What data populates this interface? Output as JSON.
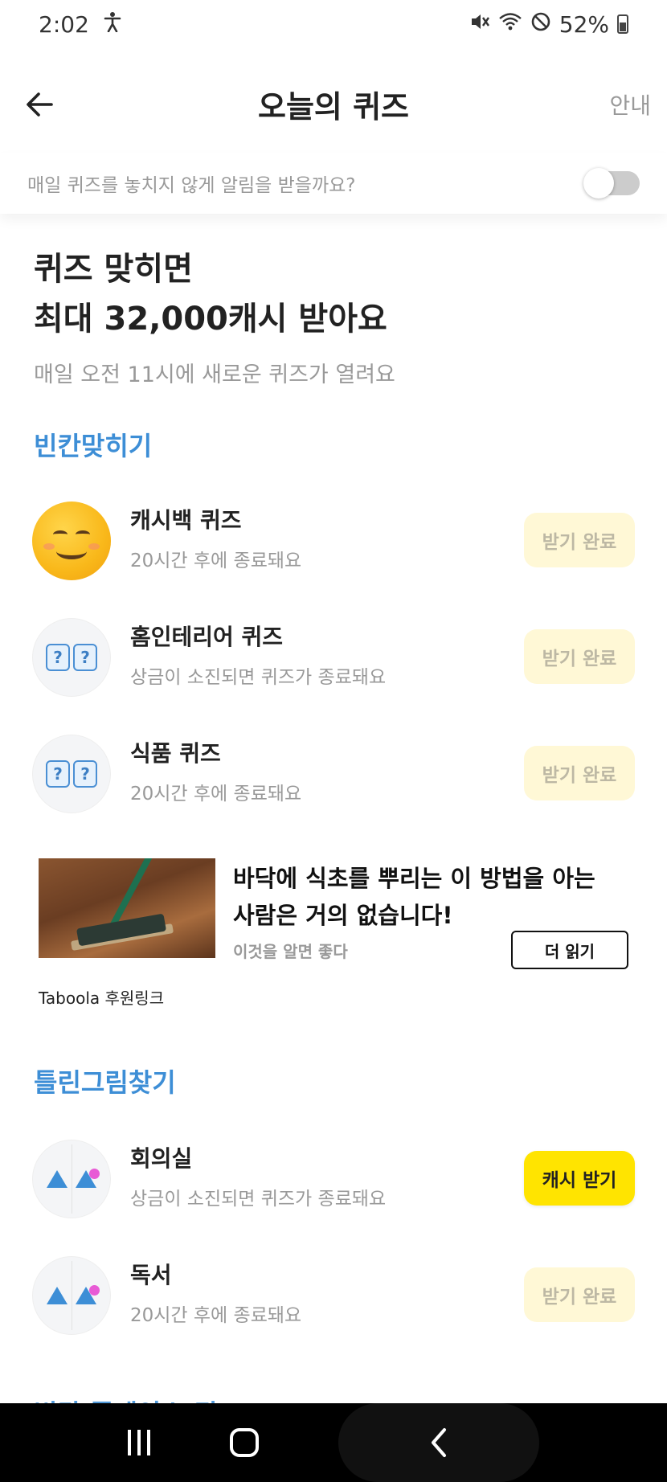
{
  "status": {
    "time": "2:02",
    "battery": "52%"
  },
  "header": {
    "title": "오늘의 퀴즈",
    "guide": "안내"
  },
  "notify": {
    "text": "매일 퀴즈를 놓치지 않게 알림을 받을까요?",
    "enabled": false
  },
  "hero": {
    "line1": "퀴즈 맞히면",
    "line2": "최대 32,000캐시 받아요",
    "sub": "매일 오전 11시에 새로운 퀴즈가 열려요"
  },
  "sections": {
    "fill_blank": {
      "title": "빈칸맞히기",
      "items": [
        {
          "title": "캐시백 퀴즈",
          "desc": "20시간 후에 종료돼요",
          "button": "받기 완료"
        },
        {
          "title": "홈인테리어 퀴즈",
          "desc": "상금이 소진되면 퀴즈가 종료돼요",
          "button": "받기 완료"
        },
        {
          "title": "식품 퀴즈",
          "desc": "20시간 후에 종료돼요",
          "button": "받기 완료"
        }
      ]
    },
    "spot_diff": {
      "title": "틀린그림찾기",
      "items": [
        {
          "title": "회의실",
          "desc": "상금이 소진되면 퀴즈가 종료돼요",
          "button": "캐시 받기"
        },
        {
          "title": "독서",
          "desc": "20시간 후에 종료돼요",
          "button": "받기 완료"
        }
      ]
    },
    "next_peek": "빈칸 플레이스 퀴즈"
  },
  "ad": {
    "headline": "바닥에 식초를 뿌리는 이 방법을 아는 사람은 거의 없습니다!",
    "source": "이것을 알면 좋다",
    "button": "더 읽기",
    "label": "Taboola 후원링크"
  },
  "icons": {
    "question_mark": "?"
  },
  "colors": {
    "accent": "#3d8ed6",
    "cash_button": "#ffe400",
    "done_button": "#fff8d6"
  }
}
